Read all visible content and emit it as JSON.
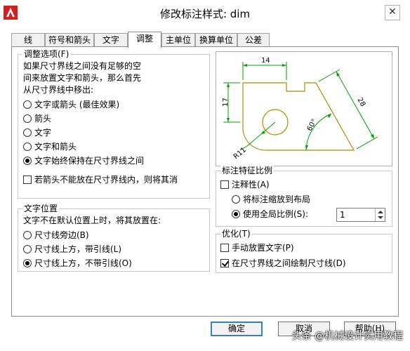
{
  "window": {
    "title": "修改标注样式: dim"
  },
  "tabs": [
    {
      "label": "线"
    },
    {
      "label": "符号和箭头"
    },
    {
      "label": "文字"
    },
    {
      "label": "调整"
    },
    {
      "label": "主单位"
    },
    {
      "label": "换算单位"
    },
    {
      "label": "公差"
    }
  ],
  "fit_options": {
    "title": "调整选项(F)",
    "desc": [
      "如果尺寸界线之间没有足够的空",
      "间来放置文字和箭头，那么首先",
      "从尺寸界线中移出:"
    ],
    "radios": [
      {
        "label": "文字或箭头 (最佳效果)",
        "checked": false
      },
      {
        "label": "箭头",
        "checked": false
      },
      {
        "label": "文字",
        "checked": false
      },
      {
        "label": "文字和箭头",
        "checked": false
      },
      {
        "label": "文字始终保持在尺寸界线之间",
        "checked": true
      }
    ],
    "checkbox": {
      "label": "若箭头不能放在尺寸界线内，则将其消",
      "checked": false
    }
  },
  "text_placement": {
    "title": "文字位置",
    "desc": "文字不在默认位置上时，将其放置在:",
    "radios": [
      {
        "label": "尺寸线旁边(B)",
        "checked": false
      },
      {
        "label": "尺寸线上方，带引线(L)",
        "checked": false
      },
      {
        "label": "尺寸线上方，不带引线(O)",
        "checked": true
      }
    ]
  },
  "preview": {
    "dim_top": "14",
    "dim_left": "17",
    "dim_right": "28",
    "dim_angle": "60°",
    "dim_radius": "R11"
  },
  "scale": {
    "title": "标注特征比例",
    "annotative": {
      "label": "注释性(A)",
      "checked": false
    },
    "layout": {
      "label": "将标注缩放到布局",
      "checked": false
    },
    "global": {
      "label": "使用全局比例(S):",
      "checked": true
    },
    "value": "1"
  },
  "fine_tune": {
    "title": "优化(T)",
    "manual": {
      "label": "手动放置文字(P)",
      "checked": false
    },
    "draw_dim_line": {
      "label": "在尺寸界线之间绘制尺寸线(D)",
      "checked": true
    }
  },
  "buttons": {
    "ok": "确定",
    "cancel": "取消",
    "help": "帮助(H)"
  },
  "watermark": "头条 @机械设计实用教程",
  "colors": {
    "geometry": "#b08a00",
    "dimension": "#00a000",
    "dimension_text": "#000000"
  }
}
